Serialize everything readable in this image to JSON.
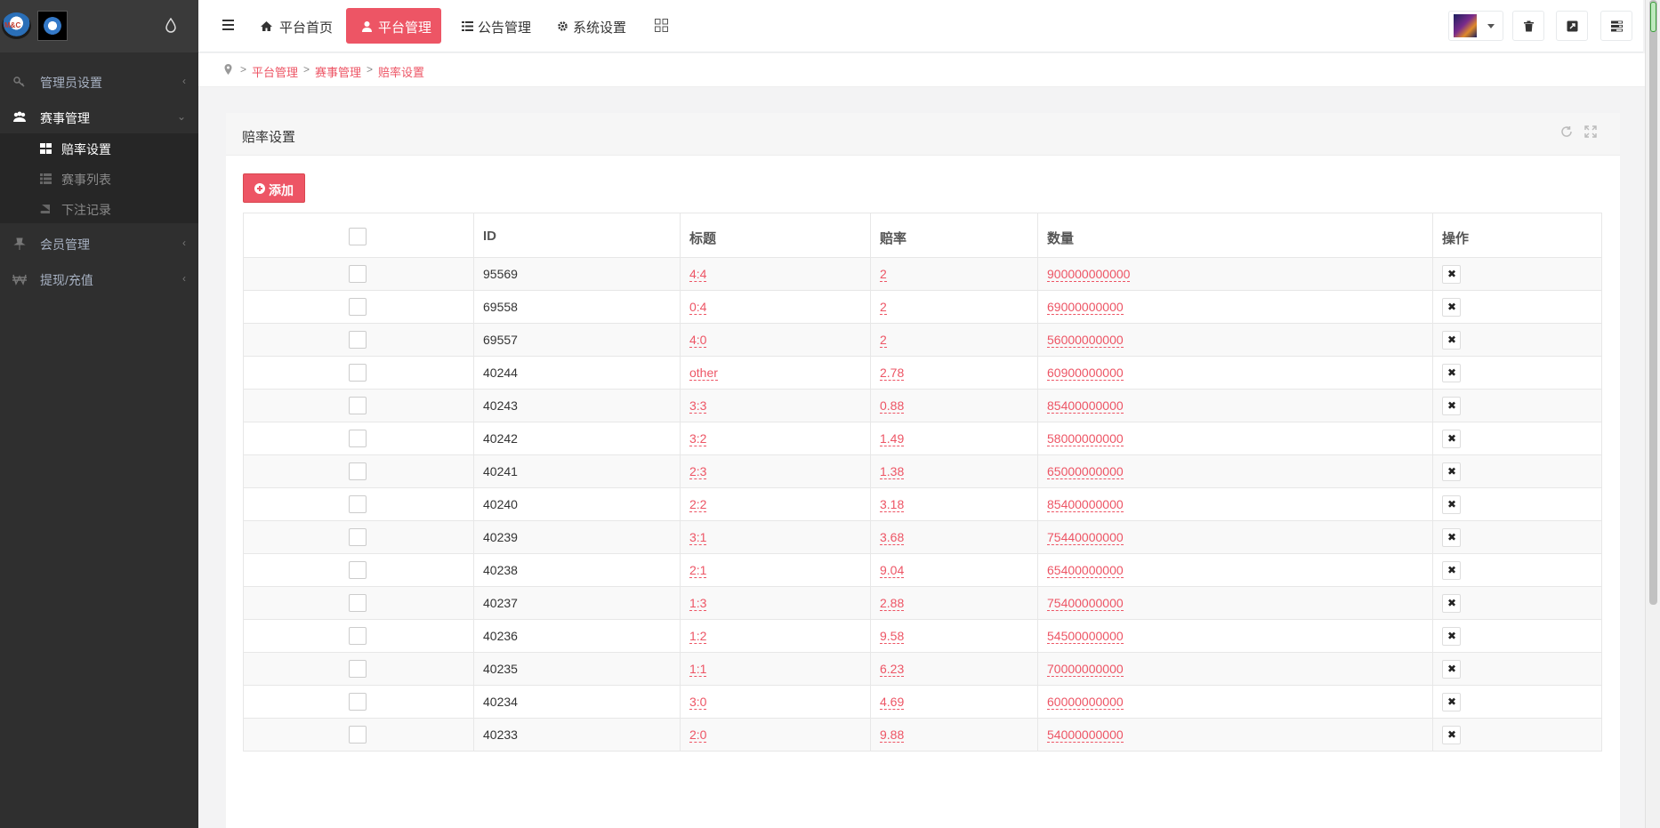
{
  "sidebar": {
    "logo_text": "M&C",
    "items": [
      {
        "label": "管理员设置",
        "icon": "key-icon"
      },
      {
        "label": "赛事管理",
        "icon": "users-icon"
      },
      {
        "label": "会员管理",
        "icon": "pushpin-icon"
      },
      {
        "label": "提现/充值",
        "icon": "won-icon"
      }
    ],
    "submenu": [
      {
        "label": "赔率设置",
        "icon": "th-large-icon"
      },
      {
        "label": "赛事列表",
        "icon": "th-list-icon"
      },
      {
        "label": "下注记录",
        "icon": "book-icon"
      }
    ]
  },
  "topbar": {
    "tabs": [
      {
        "label": "平台首页",
        "icon": "home-icon"
      },
      {
        "label": "平台管理",
        "icon": "user-icon"
      },
      {
        "label": "公告管理",
        "icon": "list-icon"
      },
      {
        "label": "系统设置",
        "icon": "cog-icon"
      }
    ]
  },
  "breadcrumb": [
    "平台管理",
    "赛事管理",
    "赔率设置"
  ],
  "panel": {
    "title": "赔率设置",
    "add_label": "添加"
  },
  "table": {
    "headers": [
      "",
      "ID",
      "标题",
      "赔率",
      "数量",
      "操作"
    ],
    "rows": [
      {
        "id": "95569",
        "title": "4:4",
        "odds": "2",
        "qty": "900000000000"
      },
      {
        "id": "69558",
        "title": "0:4",
        "odds": "2",
        "qty": "69000000000"
      },
      {
        "id": "69557",
        "title": "4:0",
        "odds": "2",
        "qty": "56000000000"
      },
      {
        "id": "40244",
        "title": "other",
        "odds": "2.78",
        "qty": "60900000000"
      },
      {
        "id": "40243",
        "title": "3:3",
        "odds": "0.88",
        "qty": "85400000000"
      },
      {
        "id": "40242",
        "title": "3:2",
        "odds": "1.49",
        "qty": "58000000000"
      },
      {
        "id": "40241",
        "title": "2:3",
        "odds": "1.38",
        "qty": "65000000000"
      },
      {
        "id": "40240",
        "title": "2:2",
        "odds": "3.18",
        "qty": "85400000000"
      },
      {
        "id": "40239",
        "title": "3:1",
        "odds": "3.68",
        "qty": "75440000000"
      },
      {
        "id": "40238",
        "title": "2:1",
        "odds": "9.04",
        "qty": "65400000000"
      },
      {
        "id": "40237",
        "title": "1:3",
        "odds": "2.88",
        "qty": "75400000000"
      },
      {
        "id": "40236",
        "title": "1:2",
        "odds": "9.58",
        "qty": "54500000000"
      },
      {
        "id": "40235",
        "title": "1:1",
        "odds": "6.23",
        "qty": "70000000000"
      },
      {
        "id": "40234",
        "title": "3:0",
        "odds": "4.69",
        "qty": "60000000000"
      },
      {
        "id": "40233",
        "title": "2:0",
        "odds": "9.88",
        "qty": "54000000000"
      }
    ]
  },
  "colors": {
    "accent": "#ed5565",
    "sidebar_bg": "#2f2f2f"
  }
}
